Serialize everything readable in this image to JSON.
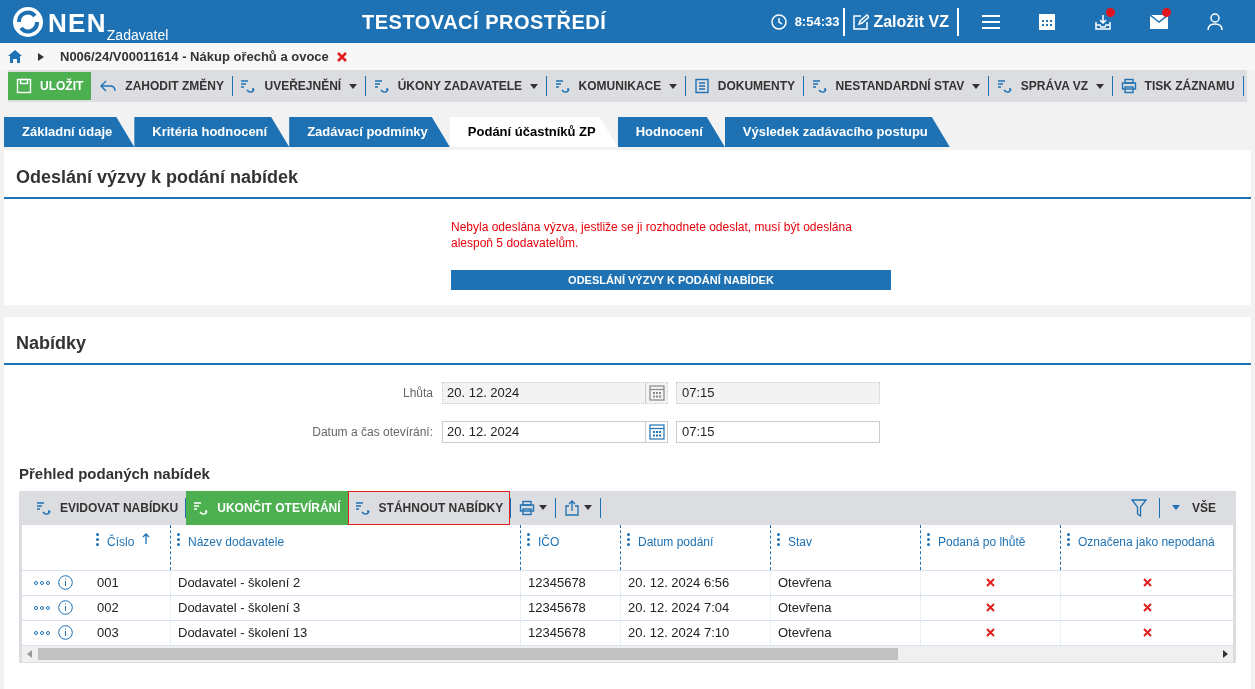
{
  "header": {
    "logo": "NEN",
    "subtitle": "Zadavatel",
    "env_title": "TESTOVACÍ PROSTŘEDÍ",
    "time": "8:54:33",
    "create_button": "Založit VZ",
    "icons": [
      {
        "kind": "menu",
        "badge": false
      },
      {
        "kind": "calendar",
        "badge": false
      },
      {
        "kind": "inbox",
        "badge": true
      },
      {
        "kind": "mail",
        "badge": true
      },
      {
        "kind": "user",
        "badge": false
      }
    ]
  },
  "breadcrumb": {
    "item": "N006/24/V00011614 - Nákup ořechů a ovoce"
  },
  "toolbar": [
    {
      "label": "ULOŽIT",
      "kind": "save",
      "dropdown": false
    },
    {
      "label": "ZAHODIT ZMĚNY",
      "kind": "undo",
      "dropdown": false
    },
    {
      "label": "UVEŘEJNĚNÍ",
      "kind": "action",
      "dropdown": true
    },
    {
      "label": "ÚKONY ZADAVATELE",
      "kind": "action",
      "dropdown": true
    },
    {
      "label": "KOMUNIKACE",
      "kind": "action",
      "dropdown": true
    },
    {
      "label": "DOKUMENTY",
      "kind": "document",
      "dropdown": false
    },
    {
      "label": "NESTANDARDNÍ STAV",
      "kind": "action",
      "dropdown": true
    },
    {
      "label": "SPRÁVA VZ",
      "kind": "action",
      "dropdown": true
    },
    {
      "label": "TISK ZÁZNAMU",
      "kind": "print",
      "dropdown": false
    }
  ],
  "tabs": [
    {
      "label": "Základní údaje",
      "selected": false
    },
    {
      "label": "Kritéria hodnocení",
      "selected": false
    },
    {
      "label": "Zadávací podmínky",
      "selected": false
    },
    {
      "label": "Podání účastníků ZP",
      "selected": true
    },
    {
      "label": "Hodnocení",
      "selected": false
    },
    {
      "label": "Výsledek zadávacího postupu",
      "selected": false
    }
  ],
  "invitation_section": {
    "title": "Odeslání výzvy k podání nabídek",
    "warning": "Nebyla odeslána výzva, jestliže se ji rozhodnete odeslat, musí být odeslána alespoň 5 dodavatelům.",
    "button": "ODESLÁNÍ VÝZVY K PODÁNÍ NABÍDEK"
  },
  "offers_section": {
    "title": "Nabídky",
    "fields": [
      {
        "label": "Lhůta",
        "date": "20. 12. 2024",
        "time": "07:15",
        "disabled": true
      },
      {
        "label": "Datum a čas otevírání:",
        "date": "20. 12. 2024",
        "time": "07:15",
        "disabled": false
      }
    ],
    "overview_title": "Přehled podaných nabídek",
    "grid_toolbar": [
      {
        "label": "EVIDOVAT NABÍDKU",
        "kind": "plain",
        "highlighted": false
      },
      {
        "label": "UKONČIT OTEVÍRÁNÍ",
        "kind": "primary",
        "highlighted": false
      },
      {
        "label": "STÁHNOUT NABÍDKY",
        "kind": "plain",
        "highlighted": true
      }
    ],
    "filter_label": "VŠE",
    "columns": [
      {
        "label": "Číslo",
        "sorted": true
      },
      {
        "label": "Název dodavatele",
        "sorted": false
      },
      {
        "label": "IČO",
        "sorted": false
      },
      {
        "label": "Datum podání",
        "sorted": false
      },
      {
        "label": "Stav",
        "sorted": false
      },
      {
        "label": "Podaná po lhůtě",
        "sorted": false
      },
      {
        "label": "Označena jako nepodaná",
        "sorted": false
      }
    ],
    "rows": [
      {
        "number": "001",
        "supplier": "Dodavatel - školení 2",
        "ico": "12345678",
        "date": "20. 12. 2024 6:56",
        "status": "Otevřena",
        "late": false,
        "not_submitted": false
      },
      {
        "number": "002",
        "supplier": "Dodavatel - školení 3",
        "ico": "12345678",
        "date": "20. 12. 2024 7:04",
        "status": "Otevřena",
        "late": false,
        "not_submitted": false
      },
      {
        "number": "003",
        "supplier": "Dodavatel - školení 13",
        "ico": "12345678",
        "date": "20. 12. 2024 7:10",
        "status": "Otevřena",
        "late": false,
        "not_submitted": false
      }
    ]
  }
}
